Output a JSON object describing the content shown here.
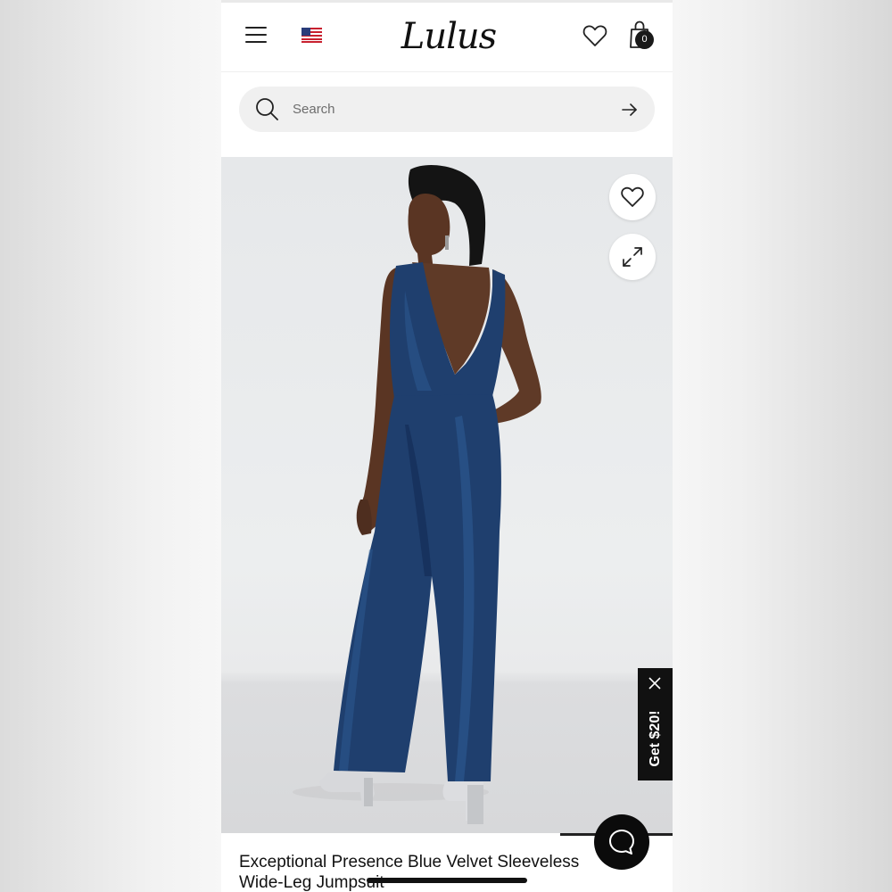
{
  "header": {
    "logo_text": "Lulus",
    "cart_count": "0"
  },
  "search": {
    "placeholder": "Search"
  },
  "promo": {
    "label": "Get $20!"
  },
  "product": {
    "title_line1": "Exceptional Presence Blue Velvet Sleeveless",
    "title_line2": "Wide-Leg Jumpsuit",
    "color": "#1f3f6e"
  },
  "icons": {
    "menu": "hamburger-menu-icon",
    "flag": "us-flag-icon",
    "wishlist": "heart-icon",
    "cart": "shopping-bag-icon",
    "search": "search-icon",
    "submit": "arrow-right-icon",
    "expand": "expand-icon",
    "close": "close-icon",
    "chat": "chat-bubble-icon"
  },
  "colors": {
    "accent": "#111111",
    "search_bg": "#f0f0f0"
  }
}
